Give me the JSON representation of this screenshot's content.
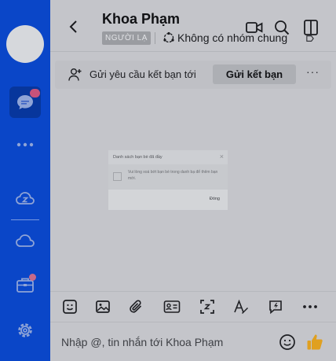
{
  "header": {
    "contact_name": "Khoa Phạm",
    "stranger_tag": "NGƯỜI LẠ",
    "group_status": "Không có nhóm chung"
  },
  "friend_request": {
    "message": "Gửi yêu cầu kết bạn tới",
    "button_label": "Gửi kết bạn",
    "more_label": "···"
  },
  "modal": {
    "title": "Danh sách bạn bè đã đầy",
    "close_label": "×",
    "message": "Vui lòng xoá bớt bạn bè trong danh bạ để thêm bạn mới.",
    "button_label": "Đóng"
  },
  "composer": {
    "placeholder": "Nhập @, tin nhắn tới Khoa Phạm",
    "value": ""
  },
  "sidebar": {
    "icons": [
      "avatar",
      "chat-icon",
      "more-dots-icon",
      "zcloud-icon",
      "cloud-icon",
      "briefcase-icon",
      "settings-icon"
    ]
  },
  "toolbar": {
    "icons": [
      "sticker-icon",
      "image-icon",
      "attachment-icon",
      "contact-card-icon",
      "screenshot-icon",
      "text-format-icon",
      "quick-message-icon",
      "more-icon"
    ]
  },
  "colors": {
    "sidebar": "#0a46c8",
    "overlay_background": "#c4c5ca",
    "badge": "#c8527a",
    "like": "#e0a020"
  }
}
